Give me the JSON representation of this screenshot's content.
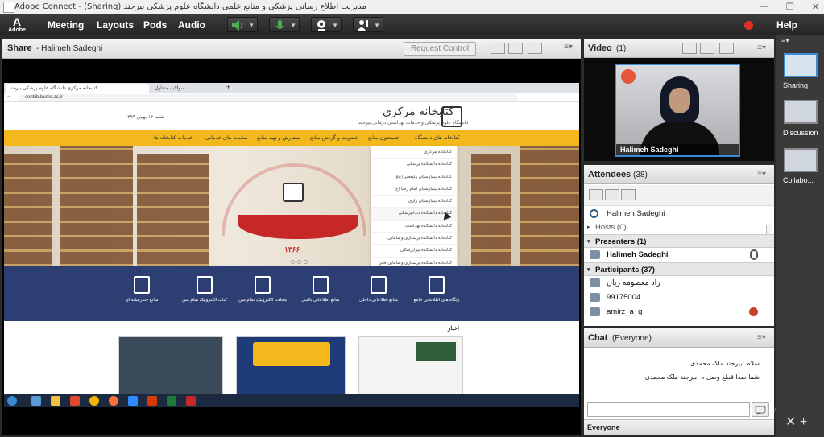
{
  "window": {
    "title": "Adobe Connect - (Sharing) مدیریت اطلاع رسانی پزشکی و منابع علمی دانشگاه علوم پزشکی بیرجند",
    "controls": [
      "—",
      "❐",
      "✕"
    ]
  },
  "menubar": {
    "logo_mark": "A",
    "logo_text": "Adobe",
    "items": [
      "Meeting",
      "Layouts",
      "Pods",
      "Audio"
    ],
    "help": "Help"
  },
  "share": {
    "title": "Share",
    "presenter": "- Halimeh Sadeghi",
    "request_control": "Request Control",
    "browser": {
      "tabs": [
        "کتابخانه مرکزی دانشگاه علوم پزشکی بیرجند",
        "سوالات متداول"
      ],
      "url": "centlib.bums.ac.ir"
    },
    "site": {
      "logo": "کتابخانه مرکزی",
      "logo_sub": "دانشگاه علوم پزشکی و خدمات بهداشتی درمانی بیرجند",
      "date_line": "شنبه ۱۴ بهمن ۱۳۹۹",
      "nav": [
        "کتابخانه های دانشگاه",
        "جستجوی منابع",
        "عضویت و گردش منابع",
        "سفارش و تهیه منابع",
        "سامانه های خدماتی",
        "خدمات کتابخانه ها"
      ],
      "dropdown": [
        "کتابخانه مرکزی",
        "کتابخانه دانشکده پزشکی",
        "کتابخانه بیمارستان ولیعصر (عج)",
        "کتابخانه بیمارستان امام رضا (ع)",
        "کتابخانه بیمارستان رازی",
        "کتابخانه دانشکده دندانپزشکی",
        "کتابخانه دانشکده بهداشت",
        "کتابخانه دانشکده پرستاری و مامایی",
        "کتابخانه دانشکده پیراپزشکی",
        "کتابخانه دانشکده پرستاری و مامایی قائن"
      ],
      "hero_year": "۱۳۶۶",
      "services": [
        "پایگاه های اطلاعاتی جامع",
        "منابع اطلاعاتی داخلی",
        "منابع اطلاعاتی بالینی",
        "مجلات الکترونیک تمام متن",
        "کتاب الکترونیک تمام متن",
        "منابع چندرسانه ای"
      ],
      "news_label": "اخبار"
    }
  },
  "video": {
    "title": "Video",
    "count": "(1)",
    "name": "Halimeh Sadeghi"
  },
  "attendees": {
    "title": "Attendees",
    "count": "(38)",
    "me": "Halimeh Sadeghi",
    "hosts_label": "Hosts (0)",
    "presenters_label": "Presenters (1)",
    "presenters": [
      "Halimeh Sadeghi"
    ],
    "participants_label": "Participants (37)",
    "participants": [
      "راد معصومه ریان",
      "99175004",
      "amirz_a_g"
    ]
  },
  "chat": {
    "title": "Chat",
    "scope": "(Everyone)",
    "messages": [
      "سلام :بیرجند ملک محمدی",
      "شما صدا قطع وصل ه :بیرجند ملک محمدی"
    ],
    "to": "Everyone"
  },
  "watermark": {
    "line1": "Activate Windows",
    "line2": "Go to Settings to activate Windows"
  },
  "layouts": {
    "items": [
      "Sharing",
      "Discussion",
      "Collabo..."
    ]
  }
}
